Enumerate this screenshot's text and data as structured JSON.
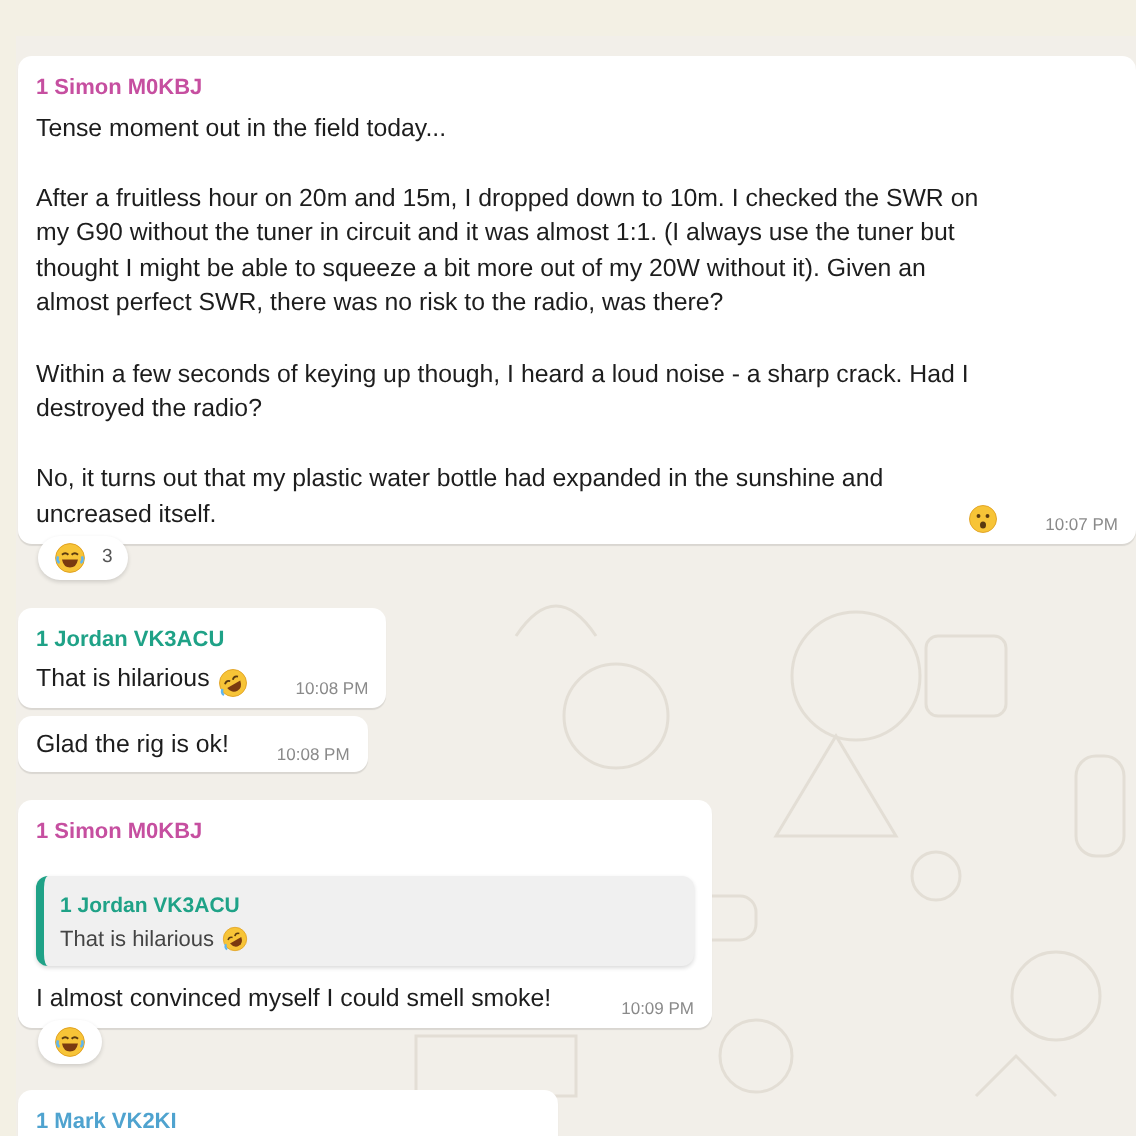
{
  "messages": [
    {
      "kind": "astonished",
      "sender": "1 Simon M0KBJ",
      "color": "#c64fa0",
      "paragraphs": [
        "Tense moment out in the field today...",
        "After a fruitless hour on 20m and 15m, I dropped down to 10m. I checked the SWR on my G90 without the tuner in circuit and it was almost 1:1. (I always use the tuner but thought I might be able to squeeze a bit more out of my 20W without it). Given an almost perfect SWR, there was no risk to the radio, was there?",
        "Within a few seconds of keying up though, I heard a loud noise - a sharp crack. Had I destroyed the radio?",
        "No, it turns out that my plastic water bottle had expanded in the sunshine and uncreased itself."
      ],
      "time": "10:07 PM",
      "reaction": {
        "kind": "laughing",
        "count": "3"
      }
    },
    {
      "kind": "laughing",
      "sender": "1 Jordan VK3ACU",
      "color": "#1fa287",
      "paragraphs": [
        "That is hilarious"
      ],
      "time": "10:08 PM"
    },
    {
      "kind": "plain",
      "paragraphs": [
        "Glad the rig is ok!"
      ],
      "time": "10:08 PM"
    },
    {
      "kind": "plain",
      "sender": "1 Simon M0KBJ",
      "color": "#c64fa0",
      "quote": {
        "kind": "laughing",
        "sender": "1 Jordan VK3ACU",
        "color": "#1fa287",
        "text": "That is hilarious"
      },
      "paragraphs": [
        "I almost convinced myself I could smell smoke!"
      ],
      "time": "10:09 PM",
      "reaction": {
        "kind": "laughing"
      }
    },
    {
      "sender": "1 Mark VK2KI",
      "color": "#4fa3cf"
    }
  ]
}
